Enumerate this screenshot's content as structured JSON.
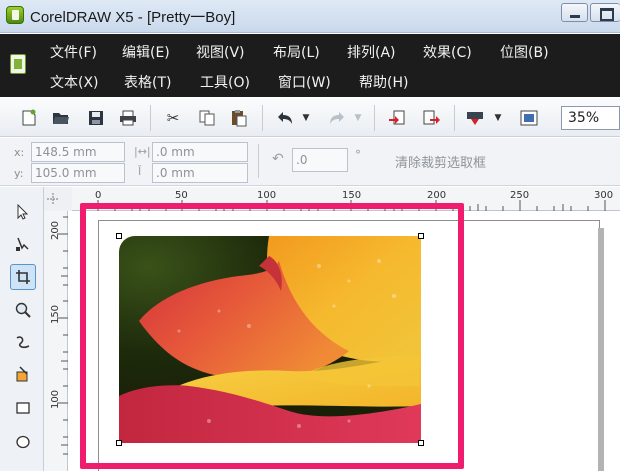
{
  "window": {
    "title": "CorelDRAW X5 - [Pretty一Boy]"
  },
  "menu": {
    "row1": [
      "文件(F)",
      "编辑(E)",
      "视图(V)",
      "布局(L)",
      "排列(A)",
      "效果(C)",
      "位图(B)"
    ],
    "row2": [
      "文本(X)",
      "表格(T)",
      "工具(O)",
      "窗口(W)",
      "帮助(H)"
    ]
  },
  "toolbar": {
    "zoom": "35%",
    "icons": [
      "new-icon",
      "open-icon",
      "save-icon",
      "print-icon",
      "cut-icon",
      "copy-icon",
      "paste-icon",
      "undo-icon",
      "redo-icon",
      "import-icon",
      "export-icon",
      "application-launcher-icon",
      "welcome-screen-icon"
    ]
  },
  "property_bar": {
    "x_label": "x:",
    "y_label": "y:",
    "x_value": "148.5 mm",
    "y_value": "105.0 mm",
    "width_value": ".0 mm",
    "height_value": ".0 mm",
    "rotation_value": ".0",
    "degree_symbol": "°",
    "clear_crop_label": "清除裁剪选取框"
  },
  "rulers": {
    "horizontal": [
      "0",
      "50",
      "100",
      "150",
      "200",
      "250",
      "300"
    ],
    "vertical": [
      "200",
      "150",
      "100"
    ]
  },
  "toolbox": {
    "tools": [
      "pick-tool-icon",
      "shape-tool-icon",
      "crop-tool-icon",
      "zoom-tool-icon",
      "freehand-tool-icon",
      "smart-fill-tool-icon",
      "rectangle-tool-icon",
      "ellipse-tool-icon"
    ]
  },
  "colors": {
    "menu_bg": "#1c1c1c",
    "highlight": "#f01d6e"
  }
}
